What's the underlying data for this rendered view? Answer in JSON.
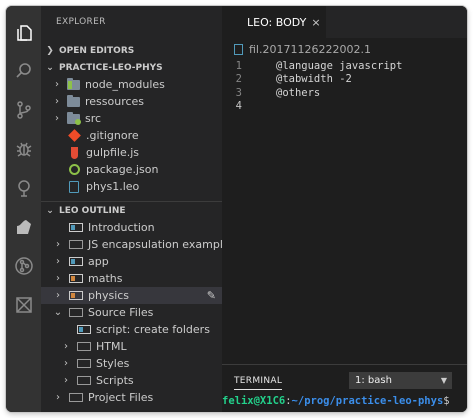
{
  "sidebar": {
    "title": "EXPLORER",
    "open_editors": "OPEN EDITORS",
    "project": "PRACTICE-LEO-PHYS",
    "files": [
      {
        "label": "node_modules"
      },
      {
        "label": "ressources"
      },
      {
        "label": "src"
      },
      {
        "label": ".gitignore"
      },
      {
        "label": "gulpfile.js"
      },
      {
        "label": "package.json"
      },
      {
        "label": "phys1.leo"
      }
    ],
    "outline_header": "LEO OUTLINE",
    "outline": [
      {
        "label": "Introduction"
      },
      {
        "label": "JS encapsulation example."
      },
      {
        "label": "app"
      },
      {
        "label": "maths"
      },
      {
        "label": "physics"
      },
      {
        "label": "Source Files"
      },
      {
        "label": "script: create folders"
      },
      {
        "label": "HTML"
      },
      {
        "label": "Styles"
      },
      {
        "label": "Scripts"
      },
      {
        "label": "Project Files"
      }
    ]
  },
  "editor": {
    "tab_label": "LEO: BODY",
    "close_glyph": "×",
    "breadcrumb": "fil.20171126222002.1",
    "lines": [
      {
        "num": "1",
        "text": "@language javascript"
      },
      {
        "num": "2",
        "text": "@tabwidth -2"
      },
      {
        "num": "3",
        "text": "@others"
      },
      {
        "num": "4",
        "text": ""
      }
    ]
  },
  "terminal": {
    "tab": "TERMINAL",
    "selector": "1: bash",
    "prompt_user": "felix@X1C6",
    "prompt_sep": ":",
    "prompt_path": "~/prog/practice-leo-phys",
    "prompt_sign": "$"
  },
  "colors": {
    "activity_bar": "#333333",
    "sidebar": "#252526",
    "editor": "#1e1e1e",
    "selection": "#37373d",
    "prompt_user": "#23d18b",
    "prompt_path": "#3b8eea"
  }
}
